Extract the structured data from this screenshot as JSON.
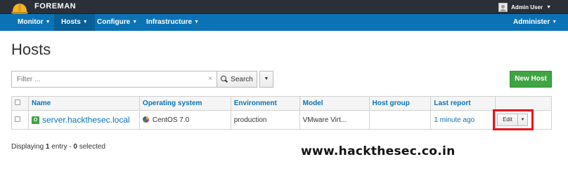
{
  "brand": {
    "name": "FOREMAN"
  },
  "user_menu": {
    "name": "Admin User"
  },
  "nav": {
    "items": [
      {
        "label": "Monitor"
      },
      {
        "label": "Hosts"
      },
      {
        "label": "Configure"
      },
      {
        "label": "Infrastructure"
      }
    ],
    "right": {
      "label": "Administer"
    }
  },
  "page": {
    "title": "Hosts"
  },
  "search": {
    "placeholder": "Filter ...",
    "clear_glyph": "×",
    "button_label": "Search"
  },
  "actions": {
    "new_host_label": "New Host",
    "edit_label": "Edit"
  },
  "table": {
    "headers": [
      "Name",
      "Operating system",
      "Environment",
      "Model",
      "Host group",
      "Last report"
    ],
    "rows": [
      {
        "status_letter": "O",
        "name": "server.hackthesec.local",
        "os": "CentOS 7.0",
        "environment": "production",
        "model": "VMware Virt...",
        "host_group": "",
        "last_report": "1 minute ago"
      }
    ]
  },
  "footer": {
    "prefix": "Displaying",
    "count": "1",
    "middle": "entry -",
    "selected": "0",
    "suffix": "selected"
  },
  "watermark": {
    "text": "www.hackthesec.co.in"
  },
  "colors": {
    "topbar": "#2a2f38",
    "navbar": "#0b72b5",
    "primary_button": "#3fa542",
    "link": "#0b72b5",
    "highlight": "#e8121a"
  }
}
